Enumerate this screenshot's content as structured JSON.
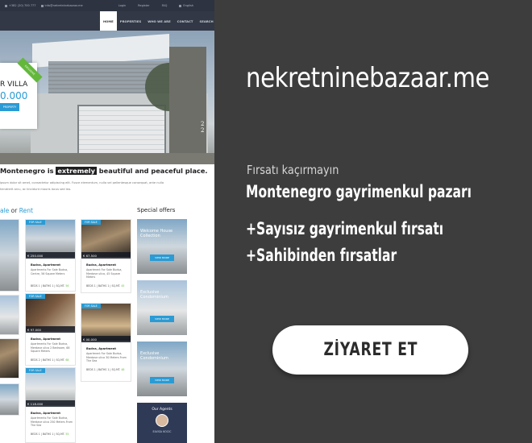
{
  "site": {
    "topbar": {
      "phone": "+382 (20) 700 777",
      "email": "info@nekretninebazaar.me",
      "login": "Login",
      "register": "Register",
      "faq": "FAQ",
      "language": "English"
    },
    "nav": [
      "HOME",
      "PROPERTIES",
      "WHO WE ARE",
      "CONTACT",
      "SEARCH"
    ],
    "hero": {
      "badge": "EXCLUSIVE",
      "title": "R VILLA",
      "price": "0.000",
      "button": "PROPERTY",
      "counter_current": "2",
      "counter_total": "2"
    },
    "headline": {
      "before": "Montenegro is ",
      "highlight": "extremely",
      "after": " beautiful and peaceful place.",
      "lorem1": "ipsum dolor sit amet, consectetur adipiscing elit. Fusce elementum, nulla vel pellentesque consequat, ante nulla",
      "lorem2": "hendrerit arcu, ac tincidunt mauris lacus sed leo."
    },
    "sale": {
      "sale": "ale",
      "or": " or ",
      "rent": "Rent"
    },
    "listings": [
      {
        "tag": "FOR SALE",
        "price": "€ 250.000",
        "name": "Budva, Apartment",
        "desc": "Apartments For Sale Budva, Centre, 56 Square Meters",
        "meta": "BEDS 1 | BATHS 1 | SQ.MT. ",
        "area": "56"
      },
      {
        "tag": "FOR SALE",
        "price": "€ 67.500",
        "name": "Budva, Apartment",
        "desc": "Apartment For Sale Budva, Merdave ulica, 45 Square Meters",
        "meta": "BEDS 1 | BATHS 1 | SQ.MT. ",
        "area": "45"
      },
      {
        "tag": "FOR SALE",
        "price": "€ 97.000",
        "name": "Budva, Apartment",
        "desc": "Apartments For Sale Budva, Merdave ulica 2 Bedroom, 68 Square Meters",
        "meta": "BEDS 2 | BATHS 1 | SQ.MT. ",
        "area": "68"
      },
      {
        "tag": "FOR SALE",
        "price": "€ 00.000",
        "name": "Budva, Apartment",
        "desc": "Apartment For Sale Budva, Merdave ulica 30 Meters From The Sea",
        "meta": "BEDS 1 | BATHS 1 | SQ.MT. ",
        "area": "48"
      },
      {
        "tag": "FOR SALE",
        "price": "€ 118.000",
        "name": "Budva, Apartment",
        "desc": "Apartments For Sale Budva, Merdave ulica 250 Meters From The Sea",
        "meta": "BEDS 1 | BATHS 1 | SQ.MT. ",
        "area": "55"
      }
    ],
    "offers": {
      "title": "Special offers",
      "items": [
        {
          "text": "Welcome House Collection",
          "button": "VIEW MORE"
        },
        {
          "text": "Exclusive Condominium",
          "button": "VIEW MORE"
        },
        {
          "text": "Exclusive Condominium",
          "button": "VIEW MORE"
        }
      ],
      "agents_title": "Our Agents",
      "agent_name": "ELVISA KOCIC"
    }
  },
  "ad": {
    "brand": "nekretninebazaar.me",
    "tagline": "Fırsatı kaçırmayın",
    "headline": "Montenegro gayrimenkul pazarı",
    "bullet1": "+Sayısız gayrimenkul fırsatı",
    "bullet2": "+Sahibinden fırsatlar",
    "cta": "ZİYARET ET"
  },
  "colors": {
    "background": "#3d3d3d",
    "accent": "#2a9bd4",
    "button_bg": "#ffffff",
    "button_text": "#2b2b2b",
    "nav_dark": "#323845"
  }
}
